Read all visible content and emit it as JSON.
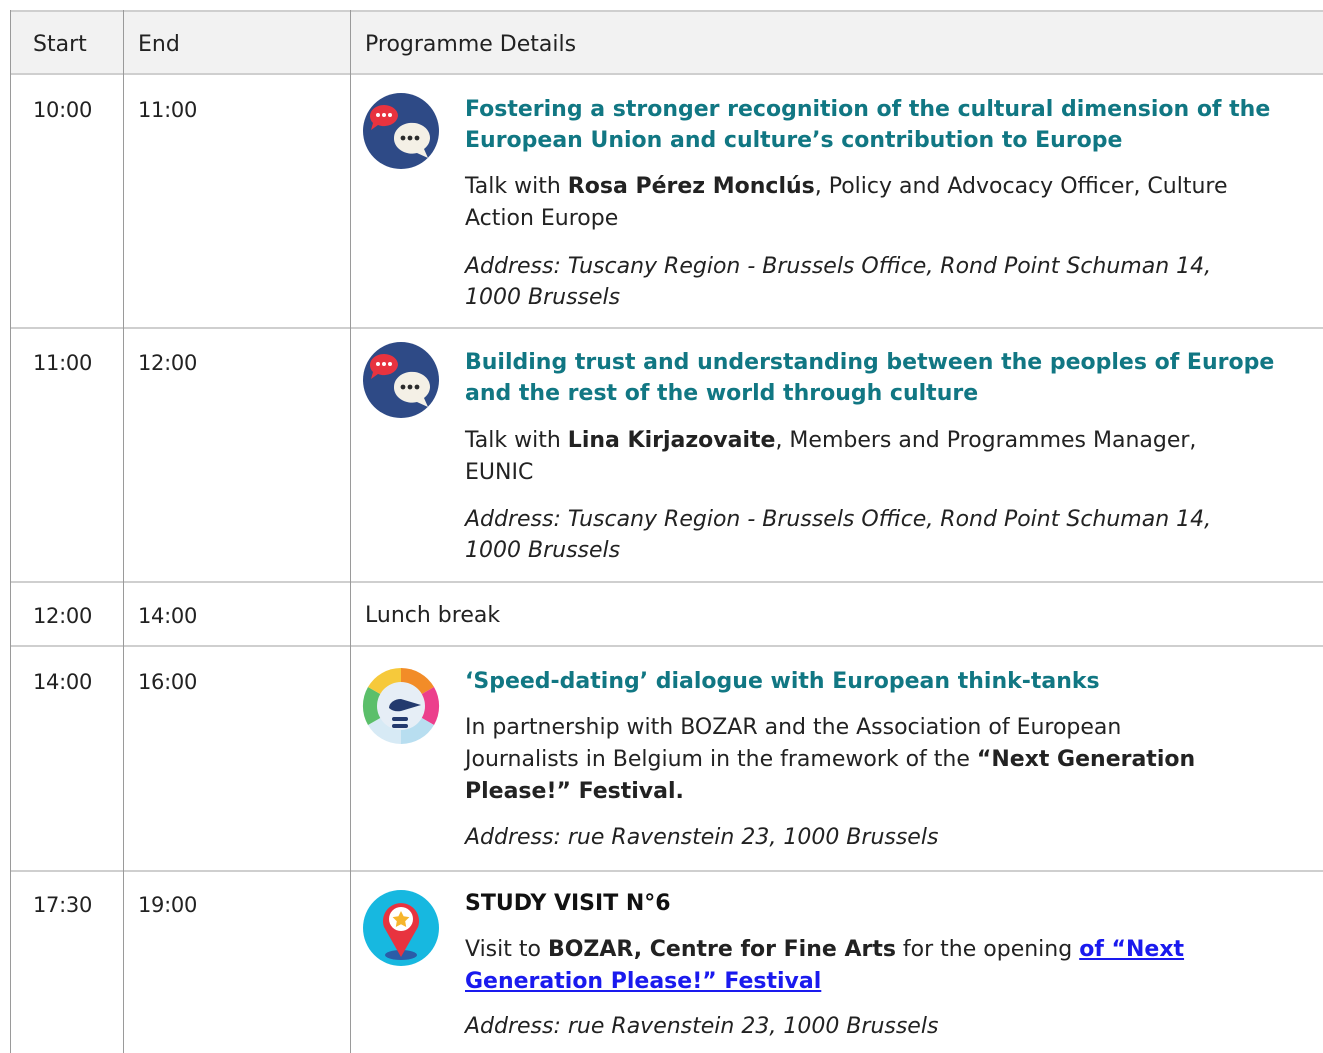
{
  "header": {
    "start": "Start",
    "end": "End",
    "details": "Programme Details"
  },
  "rows": [
    {
      "start": "10:00",
      "end": "11:00",
      "icon": "chat-bubbles-icon",
      "title_l1": "Fostering a stronger recognition of the cultural dimension of the",
      "title_l2": "European Union and culture’s contribution to Europe",
      "b1_pre": "Talk with ",
      "b1_name": "Rosa Pérez Monclús",
      "b1_post": ", Policy and Advocacy Officer, Culture",
      "b2": "Action Europe",
      "addr_l1": "Address: Tuscany Region - Brussels Office, Rond Point Schuman 14,",
      "addr_l2": "1000 Brussels"
    },
    {
      "start": "11:00",
      "end": "12:00",
      "icon": "chat-bubbles-icon",
      "title_l1": "Building trust and understanding between the peoples of Europe",
      "title_l2": "and the rest of the world through culture",
      "b1_pre": "Talk with ",
      "b1_name": "Lina Kirjazovaite",
      "b1_post": ", Members and Programmes Manager,",
      "b2": "EUNIC",
      "addr_l1": "Address: Tuscany Region - Brussels Office, Rond Point Schuman 14,",
      "addr_l2": "1000 Brussels"
    },
    {
      "start": "12:00",
      "end": "14:00",
      "text": "Lunch break"
    },
    {
      "start": "14:00",
      "end": "16:00",
      "icon": "speedometer-icon",
      "title_l1": "‘Speed-dating’ dialogue with European think-tanks",
      "b1": "In partnership with BOZAR and the Association of European",
      "b2_pre": "Journalists in Belgium in the framework of the ",
      "b2_bold": "“Next Generation",
      "b3_bold": "Please!” Festival.",
      "addr_l1": "Address: rue Ravenstein 23, 1000 Brussels"
    },
    {
      "start": "17:30",
      "end": "19:00",
      "icon": "map-pin-star-icon",
      "title": "STUDY VISIT N°6",
      "b1_pre": "Visit to ",
      "b1_bold": "BOZAR, Centre for Fine Arts",
      "b1_mid": " for the opening ",
      "link_l1": "of “Next",
      "link_l2": "Generation Please!” Festival",
      "addr_l1": "Address: rue Ravenstein 23, 1000 Brussels"
    }
  ],
  "colors": {
    "title": "#117783",
    "link": "#1a1aee",
    "header_bg": "#f2f2f2"
  }
}
